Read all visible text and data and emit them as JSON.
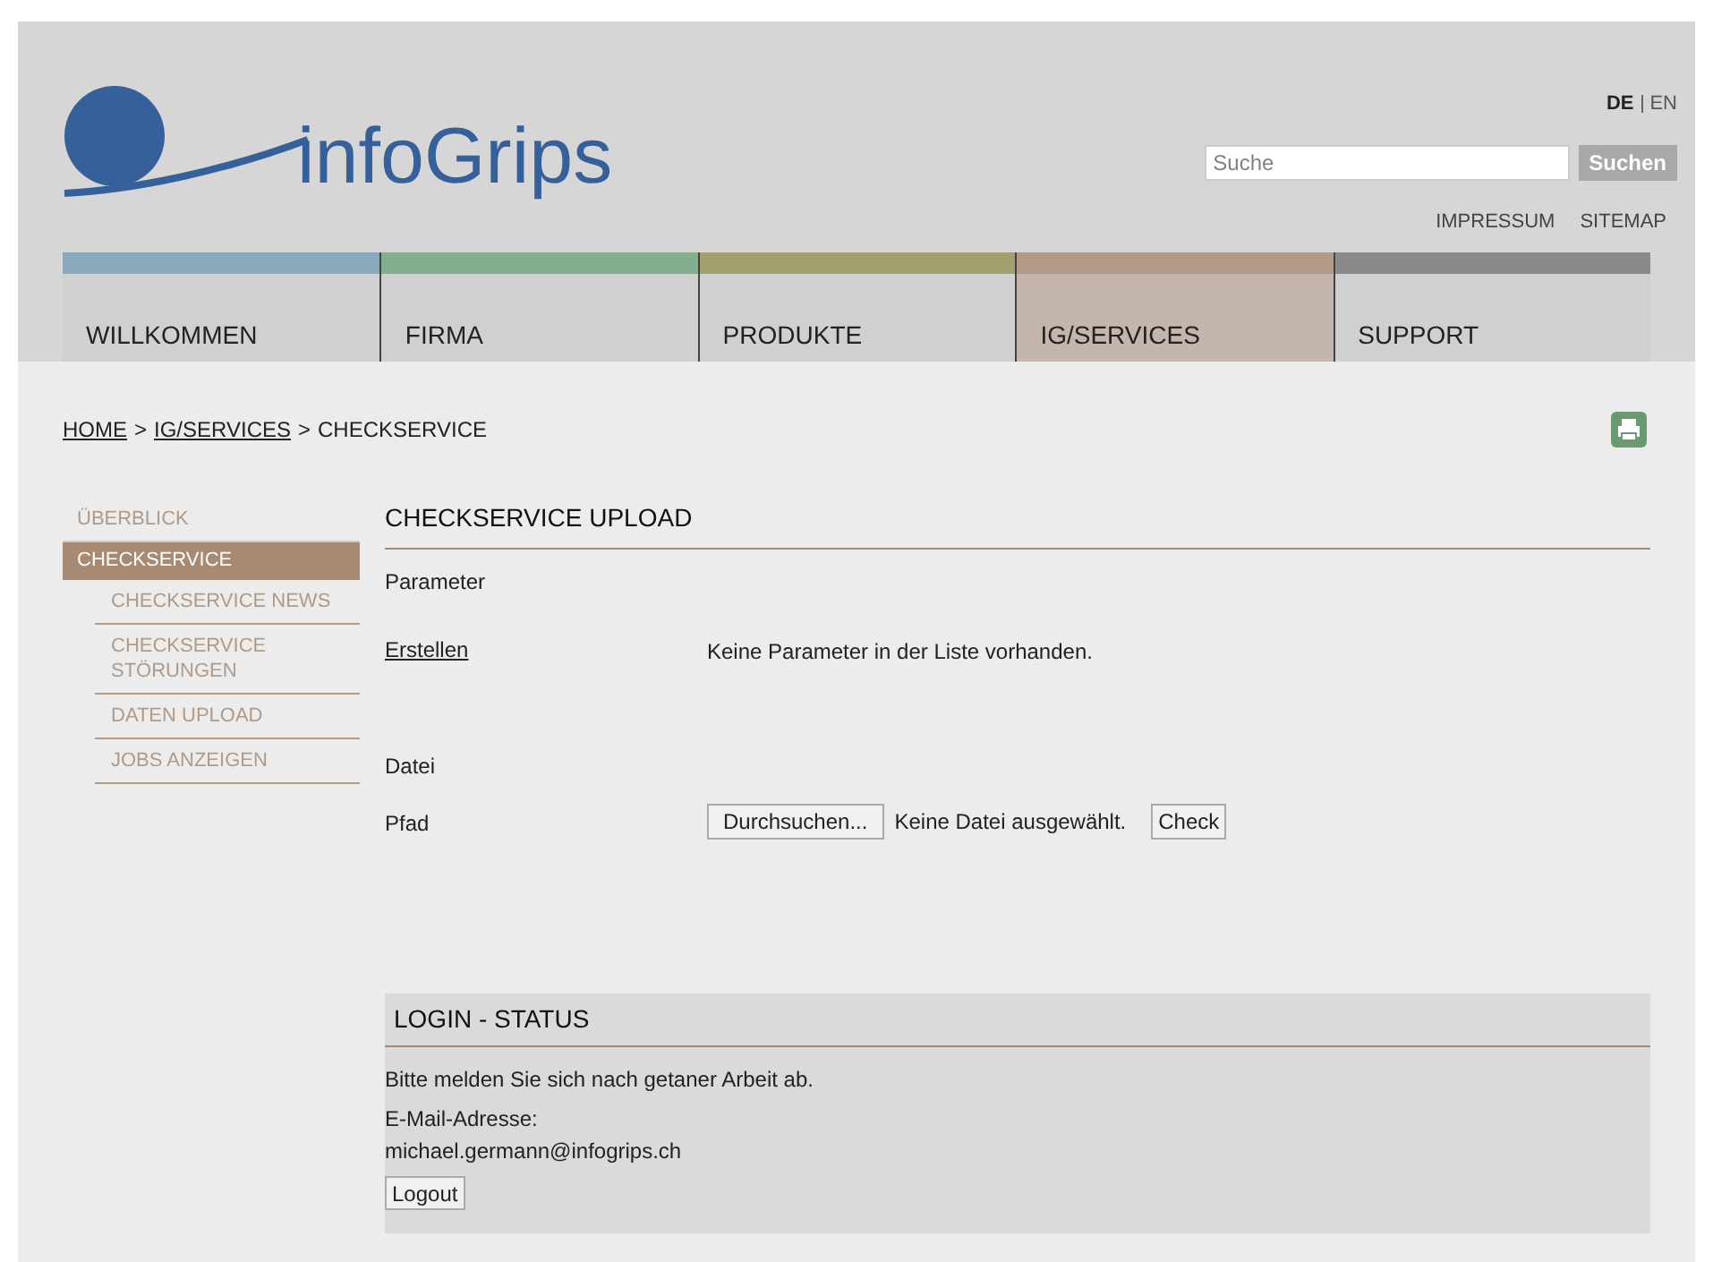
{
  "header": {
    "logo_text": "infoGrips",
    "languages": [
      {
        "label": "DE",
        "selected": true
      },
      {
        "label": "EN",
        "selected": false
      }
    ],
    "search": {
      "placeholder": "Suche",
      "button": "Suchen"
    },
    "links": [
      "IMPRESSUM",
      "SITEMAP"
    ]
  },
  "nav": [
    {
      "label": "WILLKOMMEN",
      "color": "#8ba8bd",
      "selected": false
    },
    {
      "label": "FIRMA",
      "color": "#82b08e",
      "selected": false
    },
    {
      "label": "PRODUKTE",
      "color": "#a3a06f",
      "selected": false
    },
    {
      "label": "IG/SERVICES",
      "color": "#b39a87",
      "selected": true
    },
    {
      "label": "SUPPORT",
      "color": "#8a8a8a",
      "selected": false
    }
  ],
  "breadcrumb": [
    {
      "label": "HOME",
      "link": true
    },
    {
      "label": ">",
      "link": false
    },
    {
      "label": "IG/SERVICES",
      "link": true
    },
    {
      "label": ">",
      "link": false
    },
    {
      "label": "CHECKSERVICE",
      "link": false
    }
  ],
  "sidebar": [
    {
      "label": "ÜBERBLICK",
      "selected": false
    },
    {
      "label": "CHECKSERVICE",
      "selected": true,
      "children": [
        {
          "label": "CHECKSERVICE NEWS",
          "selected": false
        },
        {
          "label": "CHECKSERVICE STÖRUNGEN",
          "selected": false
        },
        {
          "label": "DATEN UPLOAD",
          "selected": false
        },
        {
          "label": "JOBS ANZEIGEN",
          "selected": false
        }
      ]
    }
  ],
  "upload": {
    "title": "CHECKSERVICE UPLOAD",
    "parameter_label": "Parameter",
    "create_link": "Erstellen",
    "no_params": "Keine Parameter in der Liste vorhanden.",
    "file_label": "Datei",
    "path_label": "Pfad",
    "browse_button": "Durchsuchen...",
    "no_file": "Keine Datei ausgewählt.",
    "check_button": "Check"
  },
  "login": {
    "title": "LOGIN - STATUS",
    "message": "Bitte melden Sie sich nach getaner Arbeit ab.",
    "email_label": "E-Mail-Adresse:",
    "email": "michael.germann@infogrips.ch",
    "logout_button": "Logout"
  }
}
